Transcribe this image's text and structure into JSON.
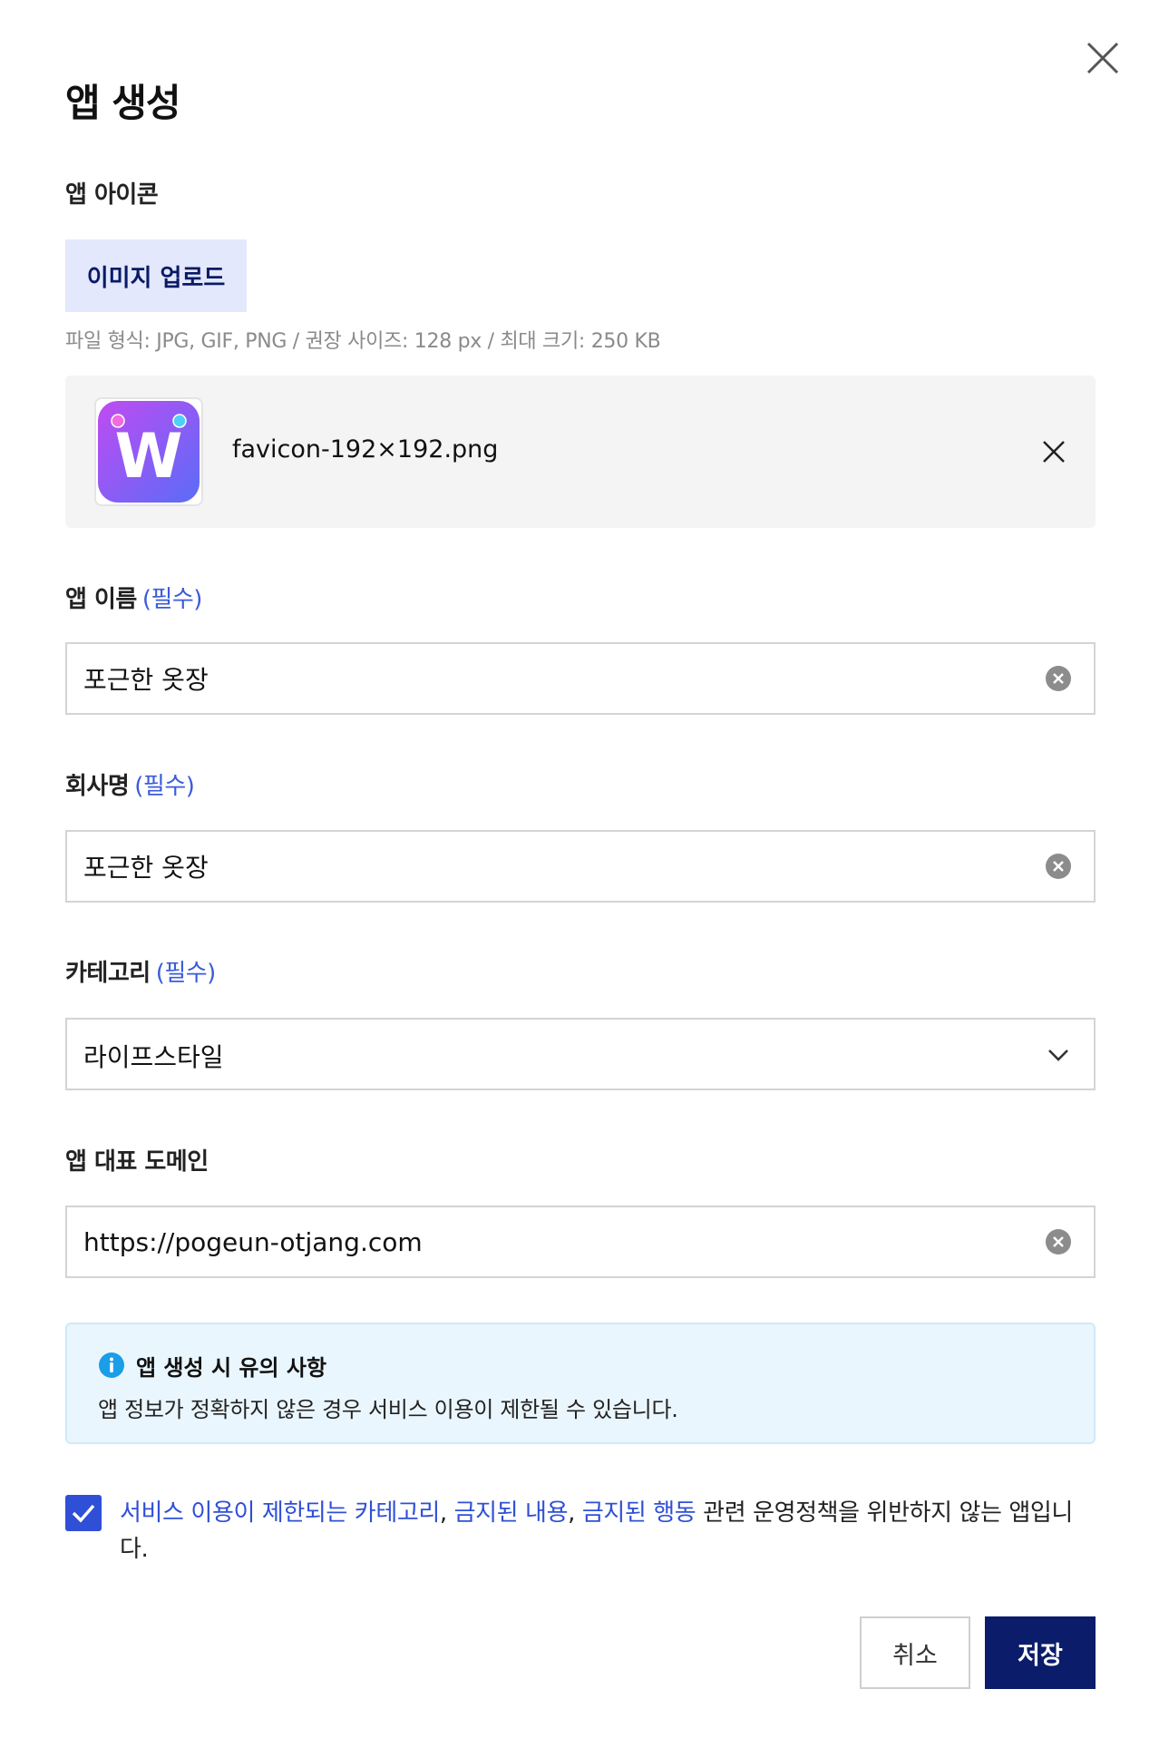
{
  "dialog": {
    "title": "앱 생성",
    "close_icon": "close-icon"
  },
  "icon_section": {
    "label": "앱 아이콘",
    "upload_label": "이미지 업로드",
    "hint": "파일 형식: JPG, GIF, PNG / 권장 사이즈: 128 px / 최대 크기: 250 KB",
    "file": {
      "name": "favicon-192×192.png",
      "thumb_letter": "W",
      "thumb_gradient": [
        "#c04bf2",
        "#5a6cf7"
      ],
      "remove_icon": "close-icon"
    }
  },
  "app_name": {
    "label": "앱 이름",
    "required": "(필수)",
    "value": "포근한 옷장"
  },
  "company": {
    "label": "회사명",
    "required": "(필수)",
    "value": "포근한 옷장"
  },
  "category": {
    "label": "카테고리",
    "required": "(필수)",
    "selected": "라이프스타일"
  },
  "domain": {
    "label": "앱 대표 도메인",
    "value": "https://pogeun-otjang.com"
  },
  "notice": {
    "title": "앱 생성 시 유의 사항",
    "body": "앱 정보가 정확하지 않은 경우 서비스 이용이 제한될 수 있습니다.",
    "icon": "info-icon"
  },
  "agreement": {
    "checked": true,
    "link1": "서비스 이용이 제한되는 카테고리",
    "sep1": ",",
    "link2": "금지된 내용",
    "sep2": ",",
    "link3": "금지된 행동",
    "rest": " 관련 운영정책을 위반하지 않는 앱입니다."
  },
  "actions": {
    "cancel": "취소",
    "save": "저장"
  },
  "colors": {
    "accent": "#2f4fd6",
    "primary_button": "#0b1c6b",
    "upload_bg": "#e3e8fd",
    "notice_bg": "#eaf6fd",
    "info_icon": "#1a9ee8"
  }
}
